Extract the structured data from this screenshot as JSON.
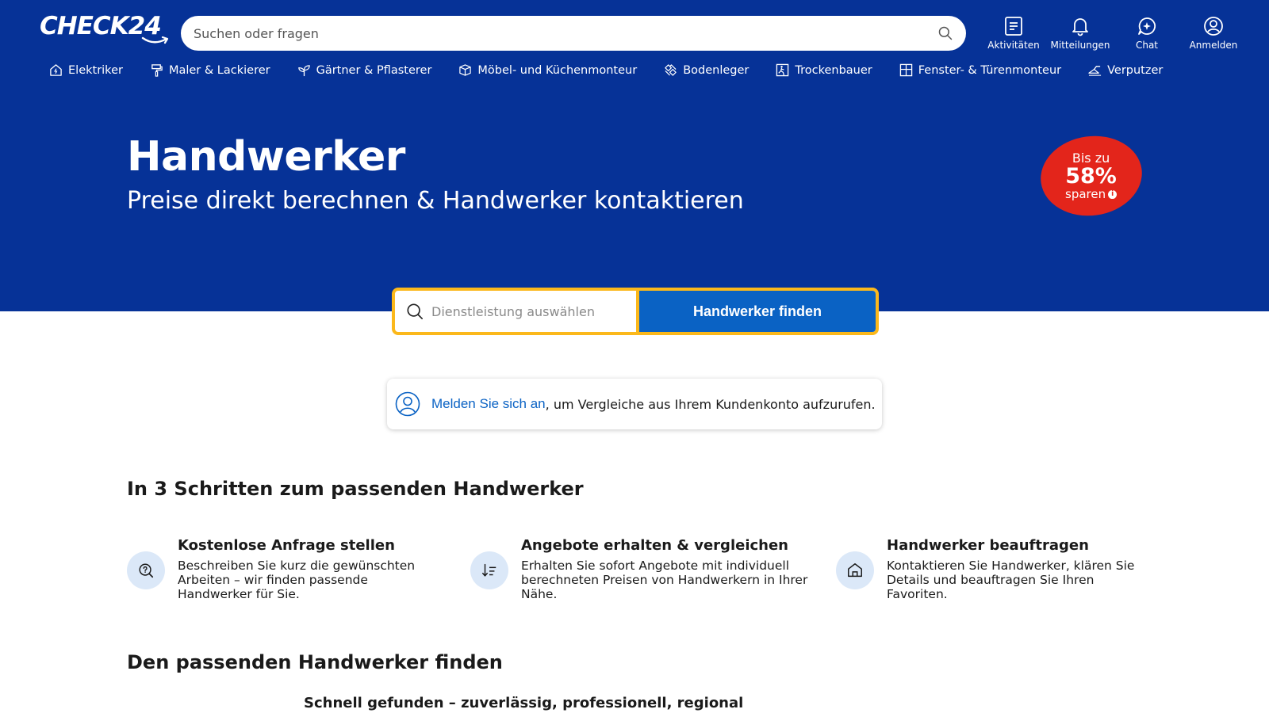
{
  "header": {
    "logo_text": "CHECK24",
    "search_placeholder": "Suchen oder fragen",
    "actions": [
      {
        "label": "Aktivitäten",
        "icon": "activities-icon"
      },
      {
        "label": "Mitteilungen",
        "icon": "bell-icon"
      },
      {
        "label": "Chat",
        "icon": "chat-icon"
      },
      {
        "label": "Anmelden",
        "icon": "user-icon"
      }
    ]
  },
  "categories": [
    {
      "label": "Elektriker",
      "icon": "house-icon"
    },
    {
      "label": "Maler & Lackierer",
      "icon": "paint-roller-icon"
    },
    {
      "label": "Gärtner & Pflasterer",
      "icon": "plant-icon"
    },
    {
      "label": "Möbel- und Küchenmonteur",
      "icon": "furniture-icon"
    },
    {
      "label": "Bodenleger",
      "icon": "floor-icon"
    },
    {
      "label": "Trockenbauer",
      "icon": "drywall-icon"
    },
    {
      "label": "Fenster- & Türenmonteur",
      "icon": "window-icon"
    },
    {
      "label": "Verputzer",
      "icon": "trowel-icon"
    }
  ],
  "hero": {
    "title": "Handwerker",
    "subtitle": "Preise direkt berechnen & Handwerker kontaktieren",
    "badge": {
      "line1": "Bis zu",
      "line2": "58%",
      "line3": "sparen",
      "info": "i"
    }
  },
  "finder": {
    "placeholder": "Dienstleistung auswählen",
    "button_label": "Handwerker finden"
  },
  "login_hint": {
    "link_text": "Melden Sie sich an",
    "rest_text": ", um Vergleiche aus Ihrem Kundenkonto aufzurufen."
  },
  "steps": {
    "title": "In 3 Schritten zum passenden Handwerker",
    "items": [
      {
        "title": "Kostenlose Anfrage stellen",
        "desc": "Beschreiben Sie kurz die gewünschten Arbeiten – wir finden passende Handwerker für Sie.",
        "icon": "question-search-icon"
      },
      {
        "title": "Angebote erhalten & vergleichen",
        "desc": "Erhalten Sie sofort Angebote mit individuell berechneten Preisen von Handwerkern in Ihrer Nähe.",
        "icon": "sort-list-icon"
      },
      {
        "title": "Handwerker beauftragen",
        "desc": "Kontaktieren Sie Handwerker, klären Sie Details und beauftragen Sie Ihren Favoriten.",
        "icon": "house-outline-icon"
      }
    ]
  },
  "find_section": {
    "title": "Den passenden Handwerker finden",
    "subtitle": "Schnell gefunden – zuverlässig, professionell, regional"
  },
  "colors": {
    "hero_blue": "#063297",
    "button_blue": "#0a62c4",
    "accent_yellow": "#fbb81b",
    "badge_red": "#e3251b",
    "step_icon_bg": "#dbe8f8"
  }
}
